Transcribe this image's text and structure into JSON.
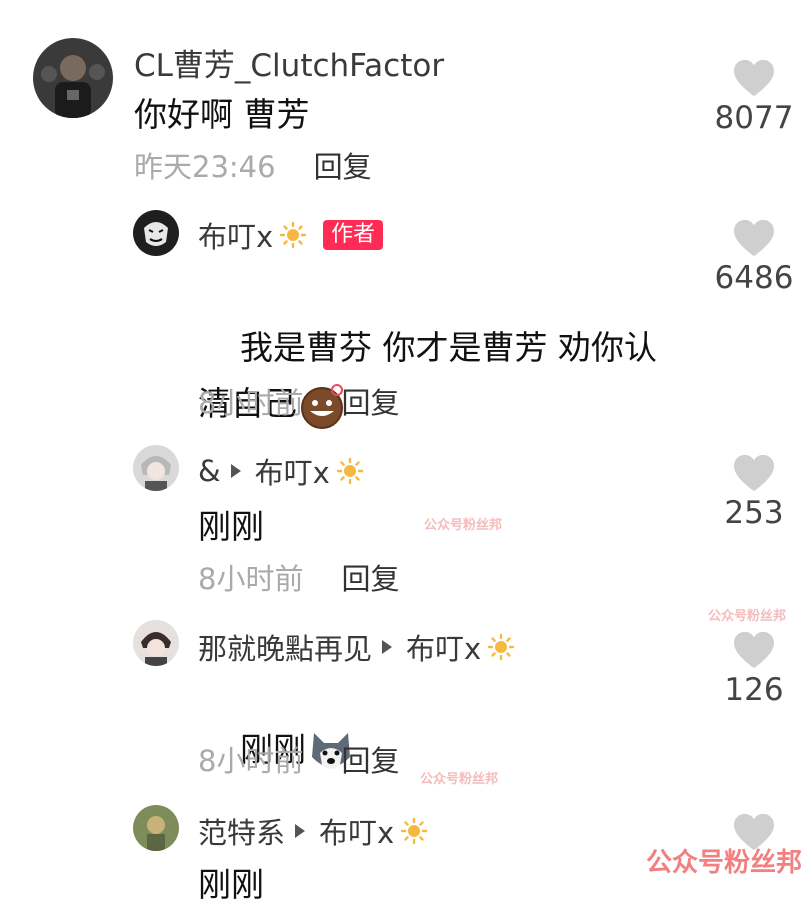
{
  "comments": [
    {
      "username": "CL曹芳_ClutchFactor",
      "text": "你好啊 曹芳",
      "time": "昨天23:46",
      "reply": "回复",
      "likes": "8077"
    },
    {
      "username": "布叮x",
      "author_tag": "作者",
      "text": "我是曹芬 你才是曹芳 劝你认\n清自己",
      "time": "8小时前",
      "reply": "回复",
      "likes": "6486",
      "emoji": "smirking-face-sticker"
    },
    {
      "username": "&",
      "reply_to": "布叮x",
      "text": "刚刚",
      "time": "8小时前",
      "reply": "回复",
      "likes": "253"
    },
    {
      "username": "那就晚點再见",
      "reply_to": "布叮x",
      "text": "刚刚",
      "time": "8小时前",
      "reply": "回复",
      "likes": "126",
      "emoji": "husky-dog-sticker"
    },
    {
      "username": "范特系",
      "reply_to": "布叮x",
      "text": "刚刚"
    }
  ],
  "watermark": "公众号粉丝邦",
  "colors": {
    "author_tag": "#fe2c55",
    "time": "#aaaaaa",
    "heart": "#cfcfcf"
  },
  "icons": [
    "heart-icon",
    "sun-icon",
    "reply-arrow-icon"
  ]
}
